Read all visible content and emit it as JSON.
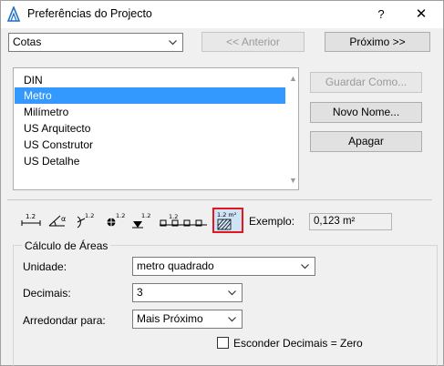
{
  "window": {
    "title": "Preferências do Projecto",
    "help": "?",
    "close": "✕"
  },
  "top": {
    "category_select": "Cotas",
    "prev_button": "<< Anterior",
    "next_button": "Próximo >>"
  },
  "list": {
    "items": [
      "DIN",
      "Metro",
      "Milímetro",
      "US Arquitecto",
      "US Construtor",
      "US Detalhe"
    ],
    "selected_index": 1
  },
  "side_buttons": {
    "save_as": "Guardar Como...",
    "new_name": "Novo Nome...",
    "delete": "Apagar"
  },
  "toolbar": {
    "tool_labels": [
      "1.2",
      "α",
      "1.2",
      "1.2",
      "1.2",
      "1.2",
      "1.2 m²"
    ],
    "active_index": 6,
    "exemplo_label": "Exemplo:",
    "exemplo_value": "0,123 m²"
  },
  "area_section": {
    "title": "Cálculo de Áreas",
    "unit_label": "Unidade:",
    "unit_value": "metro quadrado",
    "decimals_label": "Decimais:",
    "decimals_value": "3",
    "round_label": "Arredondar para:",
    "round_value": "Mais Próximo",
    "hide_decimals_label": "Esconder Decimais = Zero",
    "hide_decimals_checked": false
  },
  "colors": {
    "selection": "#3399ff",
    "active_tool_border": "#e4171f"
  }
}
